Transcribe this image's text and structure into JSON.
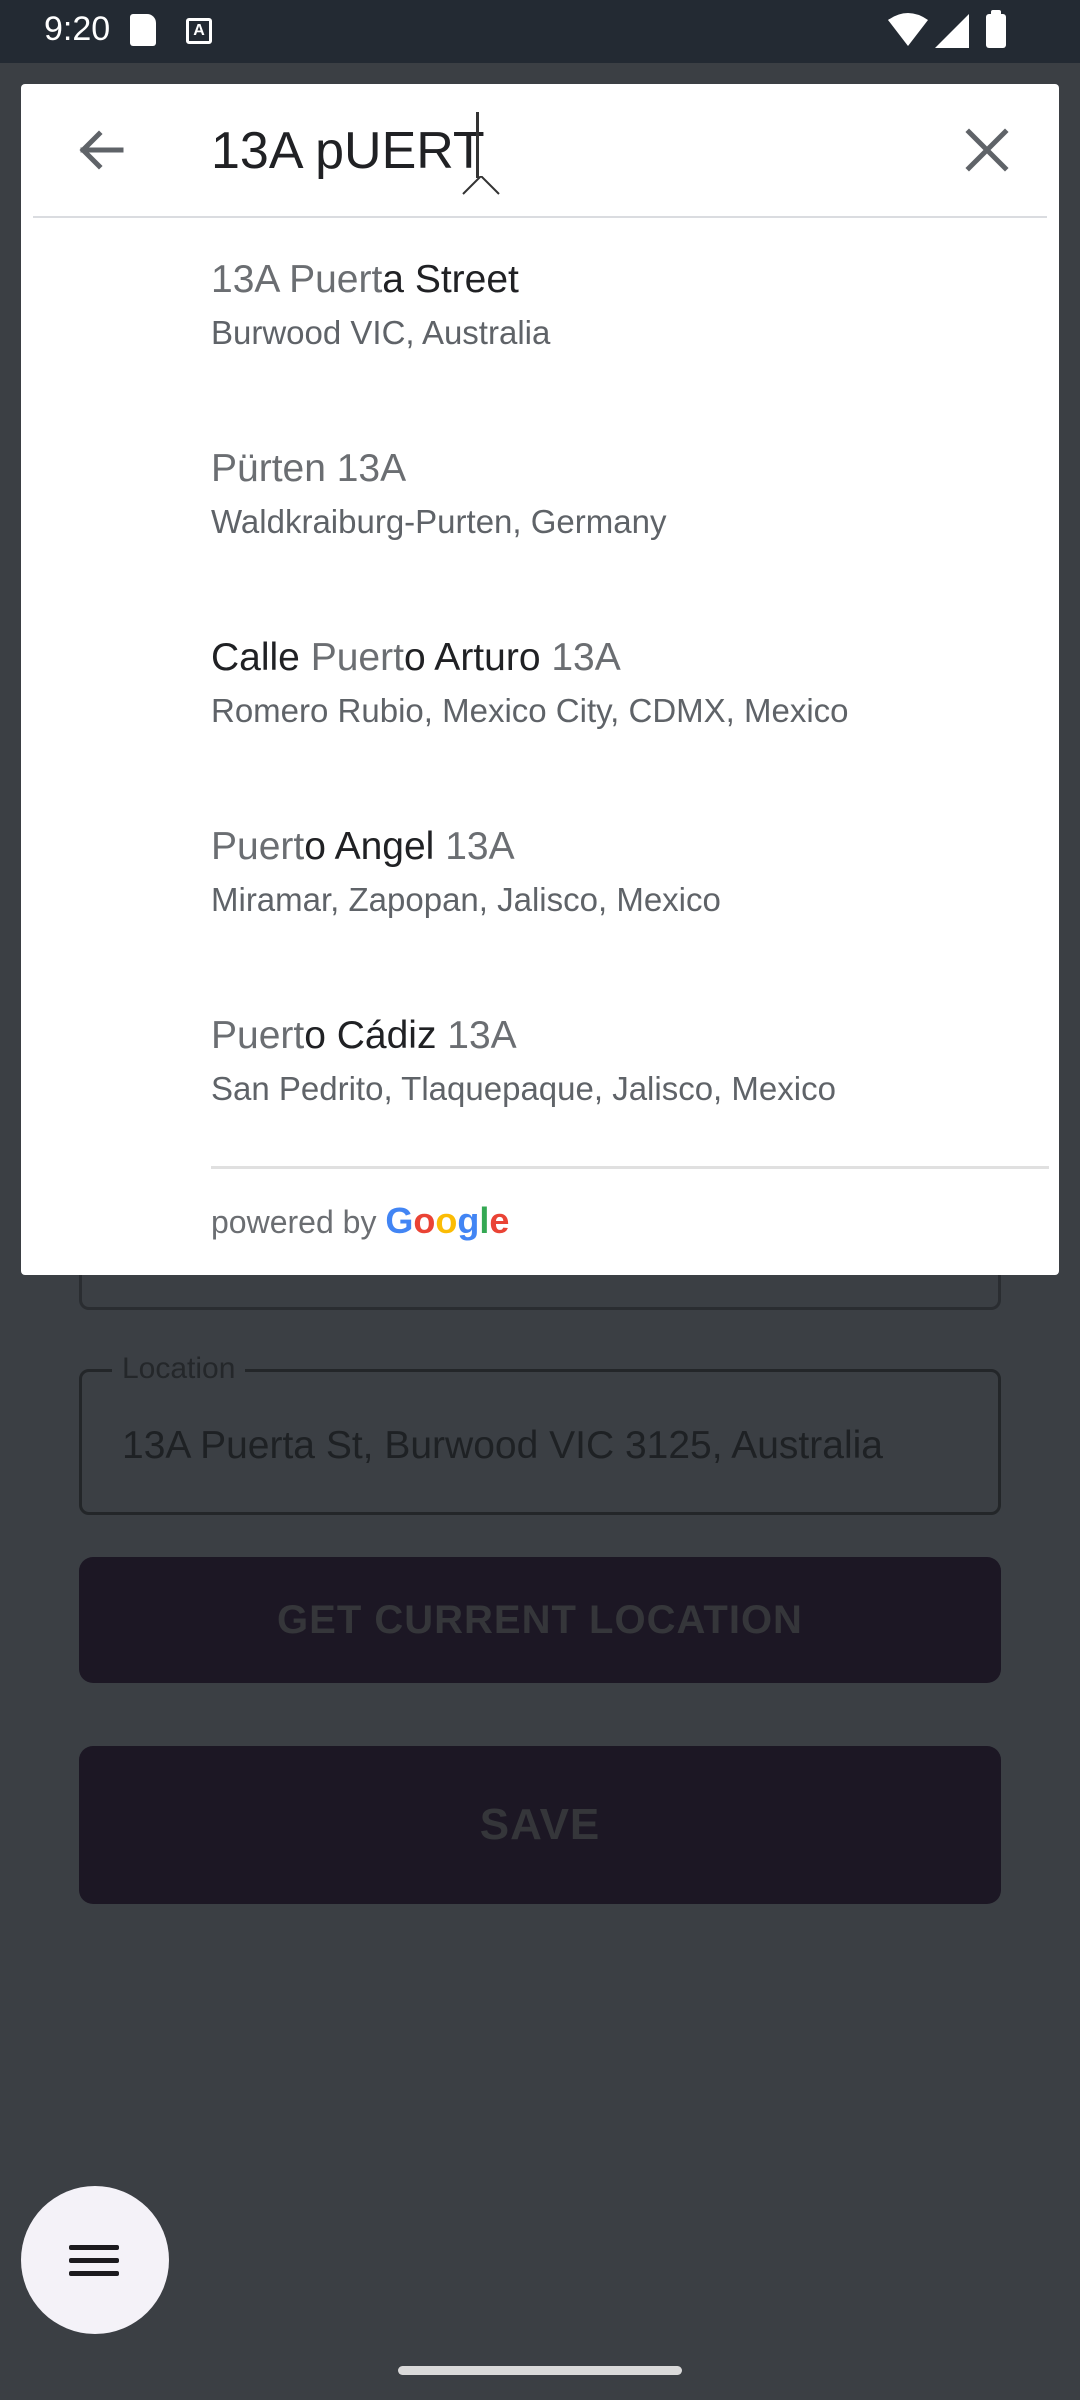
{
  "status_bar": {
    "time": "9:20"
  },
  "search": {
    "query": "13A pUERT",
    "back_icon": "arrow-left-icon",
    "clear_icon": "close-icon"
  },
  "results": [
    {
      "primary_parts": [
        {
          "t": "13A Puert",
          "m": true
        },
        {
          "t": "a Street",
          "m": false
        }
      ],
      "secondary": "Burwood VIC, Australia"
    },
    {
      "primary_parts": [
        {
          "t": "Pürten 13A",
          "m": true
        }
      ],
      "secondary": "Waldkraiburg-Purten, Germany"
    },
    {
      "primary_parts": [
        {
          "t": "Calle ",
          "m": false
        },
        {
          "t": "Puert",
          "m": true
        },
        {
          "t": "o Arturo ",
          "m": false
        },
        {
          "t": "13A",
          "m": true
        }
      ],
      "secondary": "Romero Rubio, Mexico City, CDMX, Mexico"
    },
    {
      "primary_parts": [
        {
          "t": "Puert",
          "m": true
        },
        {
          "t": "o Angel ",
          "m": false
        },
        {
          "t": "13A",
          "m": true
        }
      ],
      "secondary": "Miramar, Zapopan, Jalisco, Mexico"
    },
    {
      "primary_parts": [
        {
          "t": "Puert",
          "m": true
        },
        {
          "t": "o Cádiz ",
          "m": false
        },
        {
          "t": "13A",
          "m": true
        }
      ],
      "secondary": "San Pedrito, Tlaquepaque, Jalisco, Mexico"
    }
  ],
  "attribution": {
    "prefix": "powered by",
    "logo": "Google"
  },
  "form": {
    "location_label": "Location",
    "location_value": "13A Puerta St, Burwood VIC 3125, Australia",
    "current_location_button": "GET CURRENT LOCATION",
    "save_button": "SAVE"
  },
  "fab": {
    "icon": "menu-icon"
  }
}
